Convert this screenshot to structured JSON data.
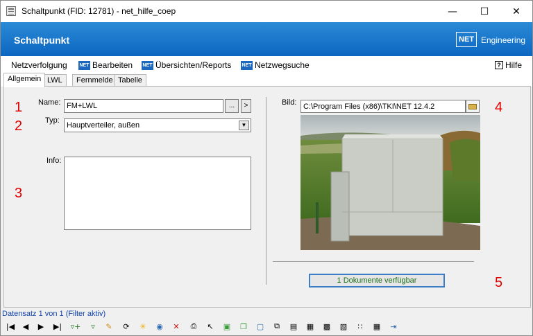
{
  "window": {
    "title": "Schaltpunkt (FID: 12781) - net_hilfe_coep"
  },
  "header": {
    "title": "Schaltpunkt",
    "logo_mark": "NET",
    "logo_text": "Engineering"
  },
  "menu": {
    "items": [
      "Netzverfolgung",
      "Bearbeiten",
      "Übersichten/Reports",
      "Netzwegsuche"
    ],
    "net_icon": "NET",
    "help": "Hilfe"
  },
  "tabs": [
    "Allgemein",
    "LWL",
    "Fernmelde",
    "Tabelle"
  ],
  "active_tab": "Allgemein",
  "form": {
    "name_label": "Name:",
    "name_value": "FM+LWL",
    "more_btn": "...",
    "next_btn": ">",
    "type_label": "Typ:",
    "type_value": "Hauptverteiler, außen",
    "info_label": "Info:",
    "info_value": "",
    "image_label": "Bild:",
    "image_path": "C:\\Program Files (x86)\\TKI\\NET 12.4.2",
    "documents_btn": "1 Dokumente verfügbar"
  },
  "annotations": [
    "1",
    "2",
    "3",
    "4",
    "5"
  ],
  "status": "Datensatz 1 von 1 (Filter aktiv)",
  "toolbar_icons": [
    "first-record-icon",
    "prev-record-icon",
    "next-record-icon",
    "last-record-icon",
    "filter-add-icon",
    "filter-icon",
    "edit-icon",
    "refresh-icon",
    "new-icon",
    "globe-icon",
    "delete-icon",
    "print-icon",
    "select-icon",
    "cube-icon",
    "copy-icon",
    "frame-icon",
    "duplicate-icon",
    "export-icon",
    "report-icon",
    "table-icon",
    "image-add-icon",
    "connect-icon",
    "grid-icon",
    "exit-icon"
  ],
  "colors": {
    "header": "#0b66c1",
    "accent": "#1c67c0",
    "annotation": "#e00000"
  }
}
